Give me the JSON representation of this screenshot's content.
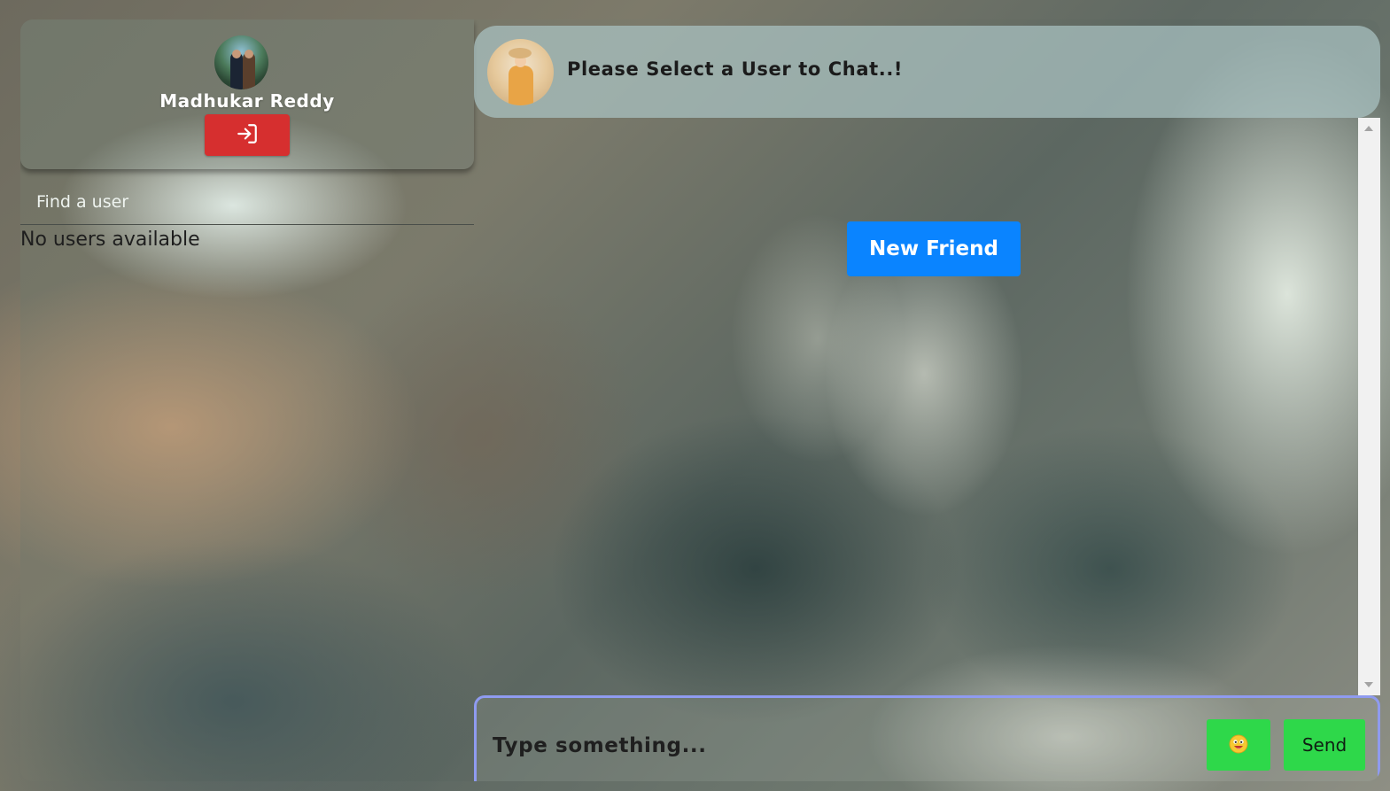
{
  "sidebar": {
    "profile": {
      "user_name": "Madhukar Reddy",
      "avatar_icon": "user-avatar",
      "logout_icon": "logout-icon",
      "logout_color": "#d62f2f"
    },
    "search": {
      "placeholder": "Find a user"
    },
    "empty_text": "No users available"
  },
  "chat": {
    "header": {
      "title": "Please Select a User to Chat..!",
      "avatar_icon": "friend-avatar"
    },
    "new_friend_label": "New Friend",
    "new_friend_color": "#0a84ff",
    "composer": {
      "placeholder": "Type something...",
      "emoji_icon": "emoji-icon",
      "send_label": "Send",
      "accent_color": "#2ed84a"
    }
  }
}
